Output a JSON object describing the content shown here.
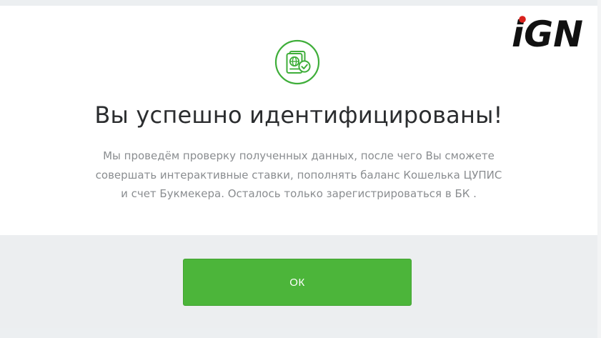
{
  "logo": {
    "text": "iGN"
  },
  "modal": {
    "icon": "passport-verified-icon",
    "title": "Вы успешно идентифицированы!",
    "description": "Мы проведём проверку полученных данных, после чего Вы сможете совершать интерактивные ставки, пополнять баланс Кошелька ЦУПИС и счет Букмекера. Осталось только зарегистрироваться в БК .",
    "ok_label": "ОК"
  },
  "colors": {
    "accent_green": "#4cb53a",
    "icon_green": "#3fae3a",
    "logo_dot": "#d9211d"
  }
}
